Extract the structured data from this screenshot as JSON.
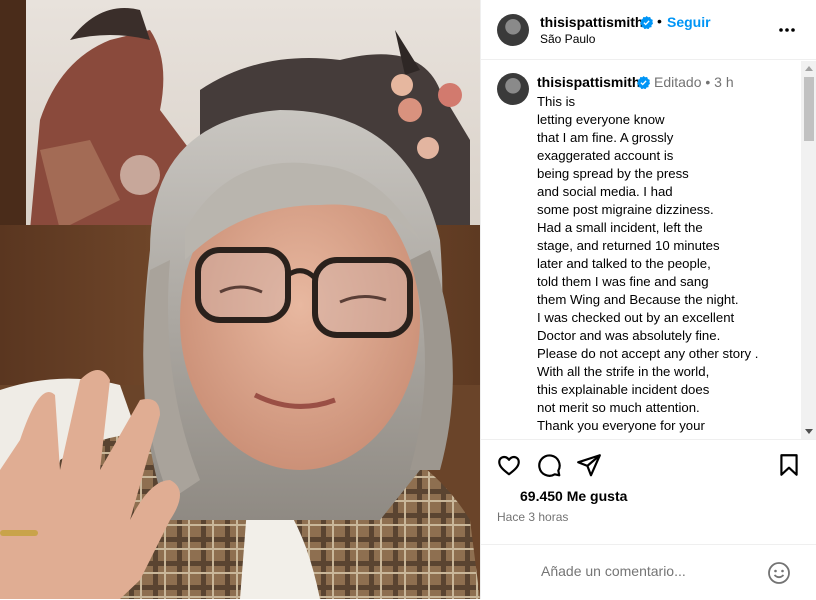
{
  "header": {
    "username": "thisispattismith",
    "separator": "•",
    "follow_label": "Seguir",
    "location": "São Paulo",
    "more_icon": "more-horizontal-icon"
  },
  "caption": {
    "username": "thisispattismith",
    "edited": "Editado • 3 h",
    "lines": [
      "This is",
      "letting everyone know",
      "that I am fine. A grossly",
      "exaggerated account is",
      "being spread by the press",
      "and social media. I had",
      "some post migraine dizziness.",
      "Had a small incident, left the",
      "stage, and returned 10 minutes",
      "later and talked to the people,",
      "told them I was fine and sang",
      "them Wing and Because the night.",
      "I was checked out by an excellent",
      "Doctor and was absolutely fine.",
      "Please do not accept any other story .",
      "With all the strife in the world,",
      "this explainable incident does",
      "not merit so much attention.",
      "Thank you everyone for your"
    ]
  },
  "actions": {
    "like_icon": "heart-icon",
    "comment_icon": "comment-icon",
    "share_icon": "send-icon",
    "save_icon": "bookmark-icon",
    "likes": "69.450 Me gusta",
    "time": "Hace 3 horas"
  },
  "comment": {
    "placeholder": "Añade un comentario...",
    "emoji_icon": "emoji-icon"
  },
  "colors": {
    "accent": "#0095f6",
    "verified": "#0095f6",
    "muted": "#737373"
  }
}
